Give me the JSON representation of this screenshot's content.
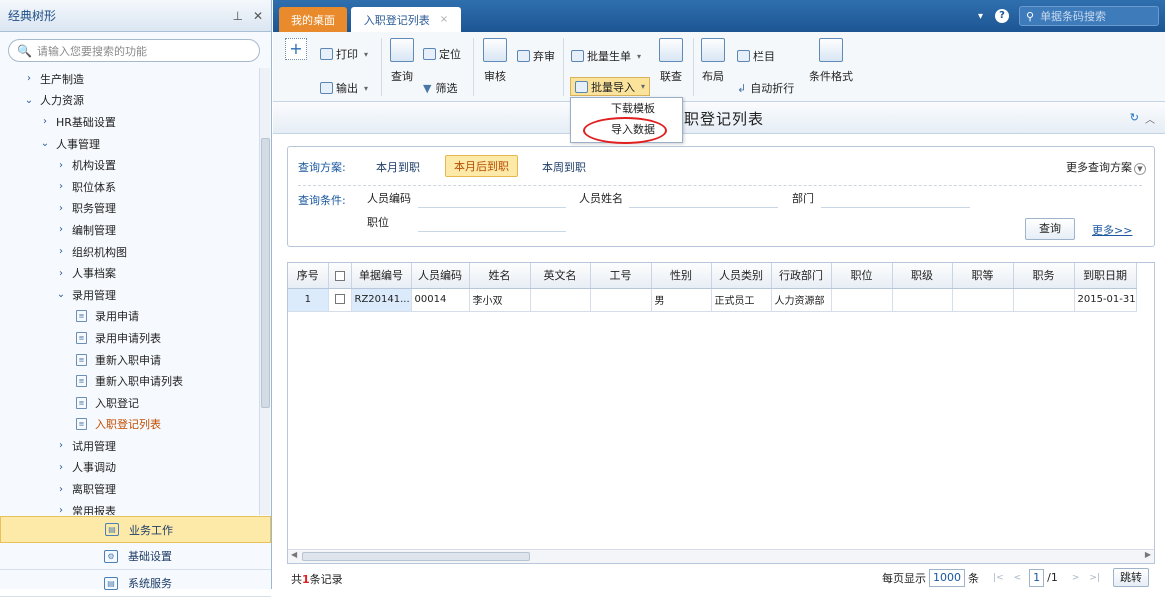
{
  "left_panel": {
    "title": "经典树形",
    "pin_icon": "pin-icon",
    "close_icon": "close-icon",
    "search_placeholder": "请输入您要搜索的功能",
    "tree": [
      {
        "label": "生产制造",
        "level": 0,
        "type": "collapsed"
      },
      {
        "label": "人力资源",
        "level": 0,
        "type": "expanded"
      },
      {
        "label": "HR基础设置",
        "level": 1,
        "type": "collapsed"
      },
      {
        "label": "人事管理",
        "level": 1,
        "type": "expanded"
      },
      {
        "label": "机构设置",
        "level": 2,
        "type": "collapsed"
      },
      {
        "label": "职位体系",
        "level": 2,
        "type": "collapsed"
      },
      {
        "label": "职务管理",
        "level": 2,
        "type": "collapsed"
      },
      {
        "label": "编制管理",
        "level": 2,
        "type": "collapsed"
      },
      {
        "label": "组织机构图",
        "level": 2,
        "type": "collapsed"
      },
      {
        "label": "人事档案",
        "level": 2,
        "type": "collapsed"
      },
      {
        "label": "录用管理",
        "level": 2,
        "type": "expanded"
      },
      {
        "label": "录用申请",
        "level": 3,
        "type": "leaf"
      },
      {
        "label": "录用申请列表",
        "level": 3,
        "type": "leaf"
      },
      {
        "label": "重新入职申请",
        "level": 3,
        "type": "leaf"
      },
      {
        "label": "重新入职申请列表",
        "level": 3,
        "type": "leaf"
      },
      {
        "label": "入职登记",
        "level": 3,
        "type": "leaf"
      },
      {
        "label": "入职登记列表",
        "level": 3,
        "type": "leaf",
        "selected": true
      },
      {
        "label": "试用管理",
        "level": 2,
        "type": "collapsed"
      },
      {
        "label": "人事调动",
        "level": 2,
        "type": "collapsed"
      },
      {
        "label": "离职管理",
        "level": 2,
        "type": "collapsed"
      },
      {
        "label": "常用报表",
        "level": 2,
        "type": "collapsed"
      }
    ],
    "bottom_nav": [
      {
        "label": "业务工作",
        "active": true,
        "icon": "business-icon"
      },
      {
        "label": "基础设置",
        "active": false,
        "icon": "gear-icon"
      },
      {
        "label": "系统服务",
        "active": false,
        "icon": "service-icon"
      }
    ]
  },
  "tabs": {
    "desk": "我的桌面",
    "current": "入职登记列表",
    "close": "×"
  },
  "top_right": {
    "search_placeholder": "单据条码搜索"
  },
  "toolbar": {
    "print": "打印",
    "export": "输出",
    "query": "查询",
    "locate": "定位",
    "filter": "筛选",
    "audit": "审核",
    "abandon": "弃审",
    "batch_generate": "批量生单",
    "batch_import": "批量导入",
    "link_query": "联查",
    "layout": "布局",
    "columns": "栏目",
    "auto_wrap": "自动折行",
    "conditional_format": "条件格式"
  },
  "dropdown": {
    "items": [
      "下载模板",
      "导入数据"
    ]
  },
  "page_title": "入职登记列表",
  "page_title_visible": "职登记列表",
  "query": {
    "plan_label": "查询方案:",
    "plans": [
      "本月到职",
      "本月后到职",
      "本周到职"
    ],
    "more_plans": "更多查询方案",
    "cond_label": "查询条件:",
    "fields": {
      "emp_code": "人员编码",
      "emp_name": "人员姓名",
      "dept": "部门",
      "position": "职位"
    },
    "query_button": "查询",
    "more_link": "更多>>"
  },
  "grid": {
    "headers": [
      "序号",
      "",
      "单据编号",
      "人员编码",
      "姓名",
      "英文名",
      "工号",
      "性别",
      "人员类别",
      "行政部门",
      "职位",
      "职级",
      "职等",
      "职务",
      "到职日期"
    ],
    "rows": [
      [
        "1",
        "",
        "RZ20141...",
        "00014",
        "李小双",
        "",
        "",
        "男",
        "正式员工",
        "人力资源部",
        "",
        "",
        "",
        "",
        "2015-01-31"
      ]
    ]
  },
  "footer": {
    "total_prefix": "共",
    "total_count": "1",
    "total_suffix": "条记录",
    "per_page_label": "每页显示",
    "per_page_value": "1000",
    "per_page_unit": "条",
    "current_page": "1",
    "total_pages": "/1",
    "jump": "跳转"
  }
}
